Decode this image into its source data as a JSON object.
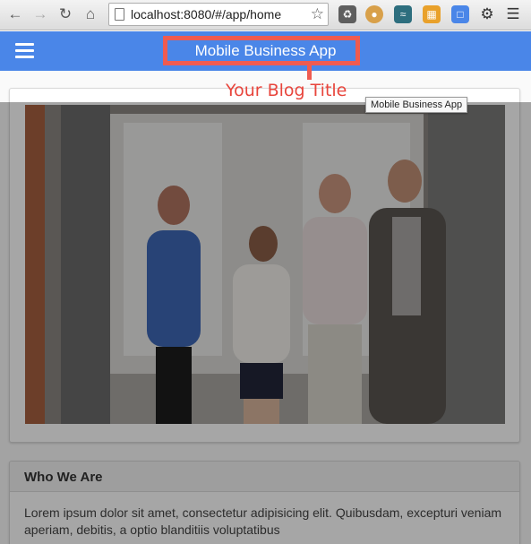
{
  "browser": {
    "url": "localhost:8080/#/app/home",
    "extensions": [
      {
        "icon": "recycle-icon",
        "color": "#5e5e5e"
      },
      {
        "icon": "cookie-icon",
        "color": "#d8a04a"
      },
      {
        "icon": "wave-icon",
        "color": "#2d6e7e"
      },
      {
        "icon": "hierarchy-icon",
        "color": "#e9a12b"
      },
      {
        "icon": "folder-icon",
        "color": "#4a86e8"
      },
      {
        "icon": "gear-icon",
        "color": "#333333"
      },
      {
        "icon": "menu-icon",
        "color": "#333333"
      }
    ]
  },
  "app": {
    "title": "Mobile Business App",
    "header_color": "#4a86e8"
  },
  "annotation": {
    "label": "Your Blog Title",
    "color": "#ef5b50"
  },
  "tooltip": {
    "text": "Mobile Business App"
  },
  "about": {
    "heading": "Who We Are",
    "body": "Lorem ipsum dolor sit amet, consectetur adipisicing elit. Quibusdam, excepturi veniam aperiam, debitis, a optio blanditiis voluptatibus"
  }
}
